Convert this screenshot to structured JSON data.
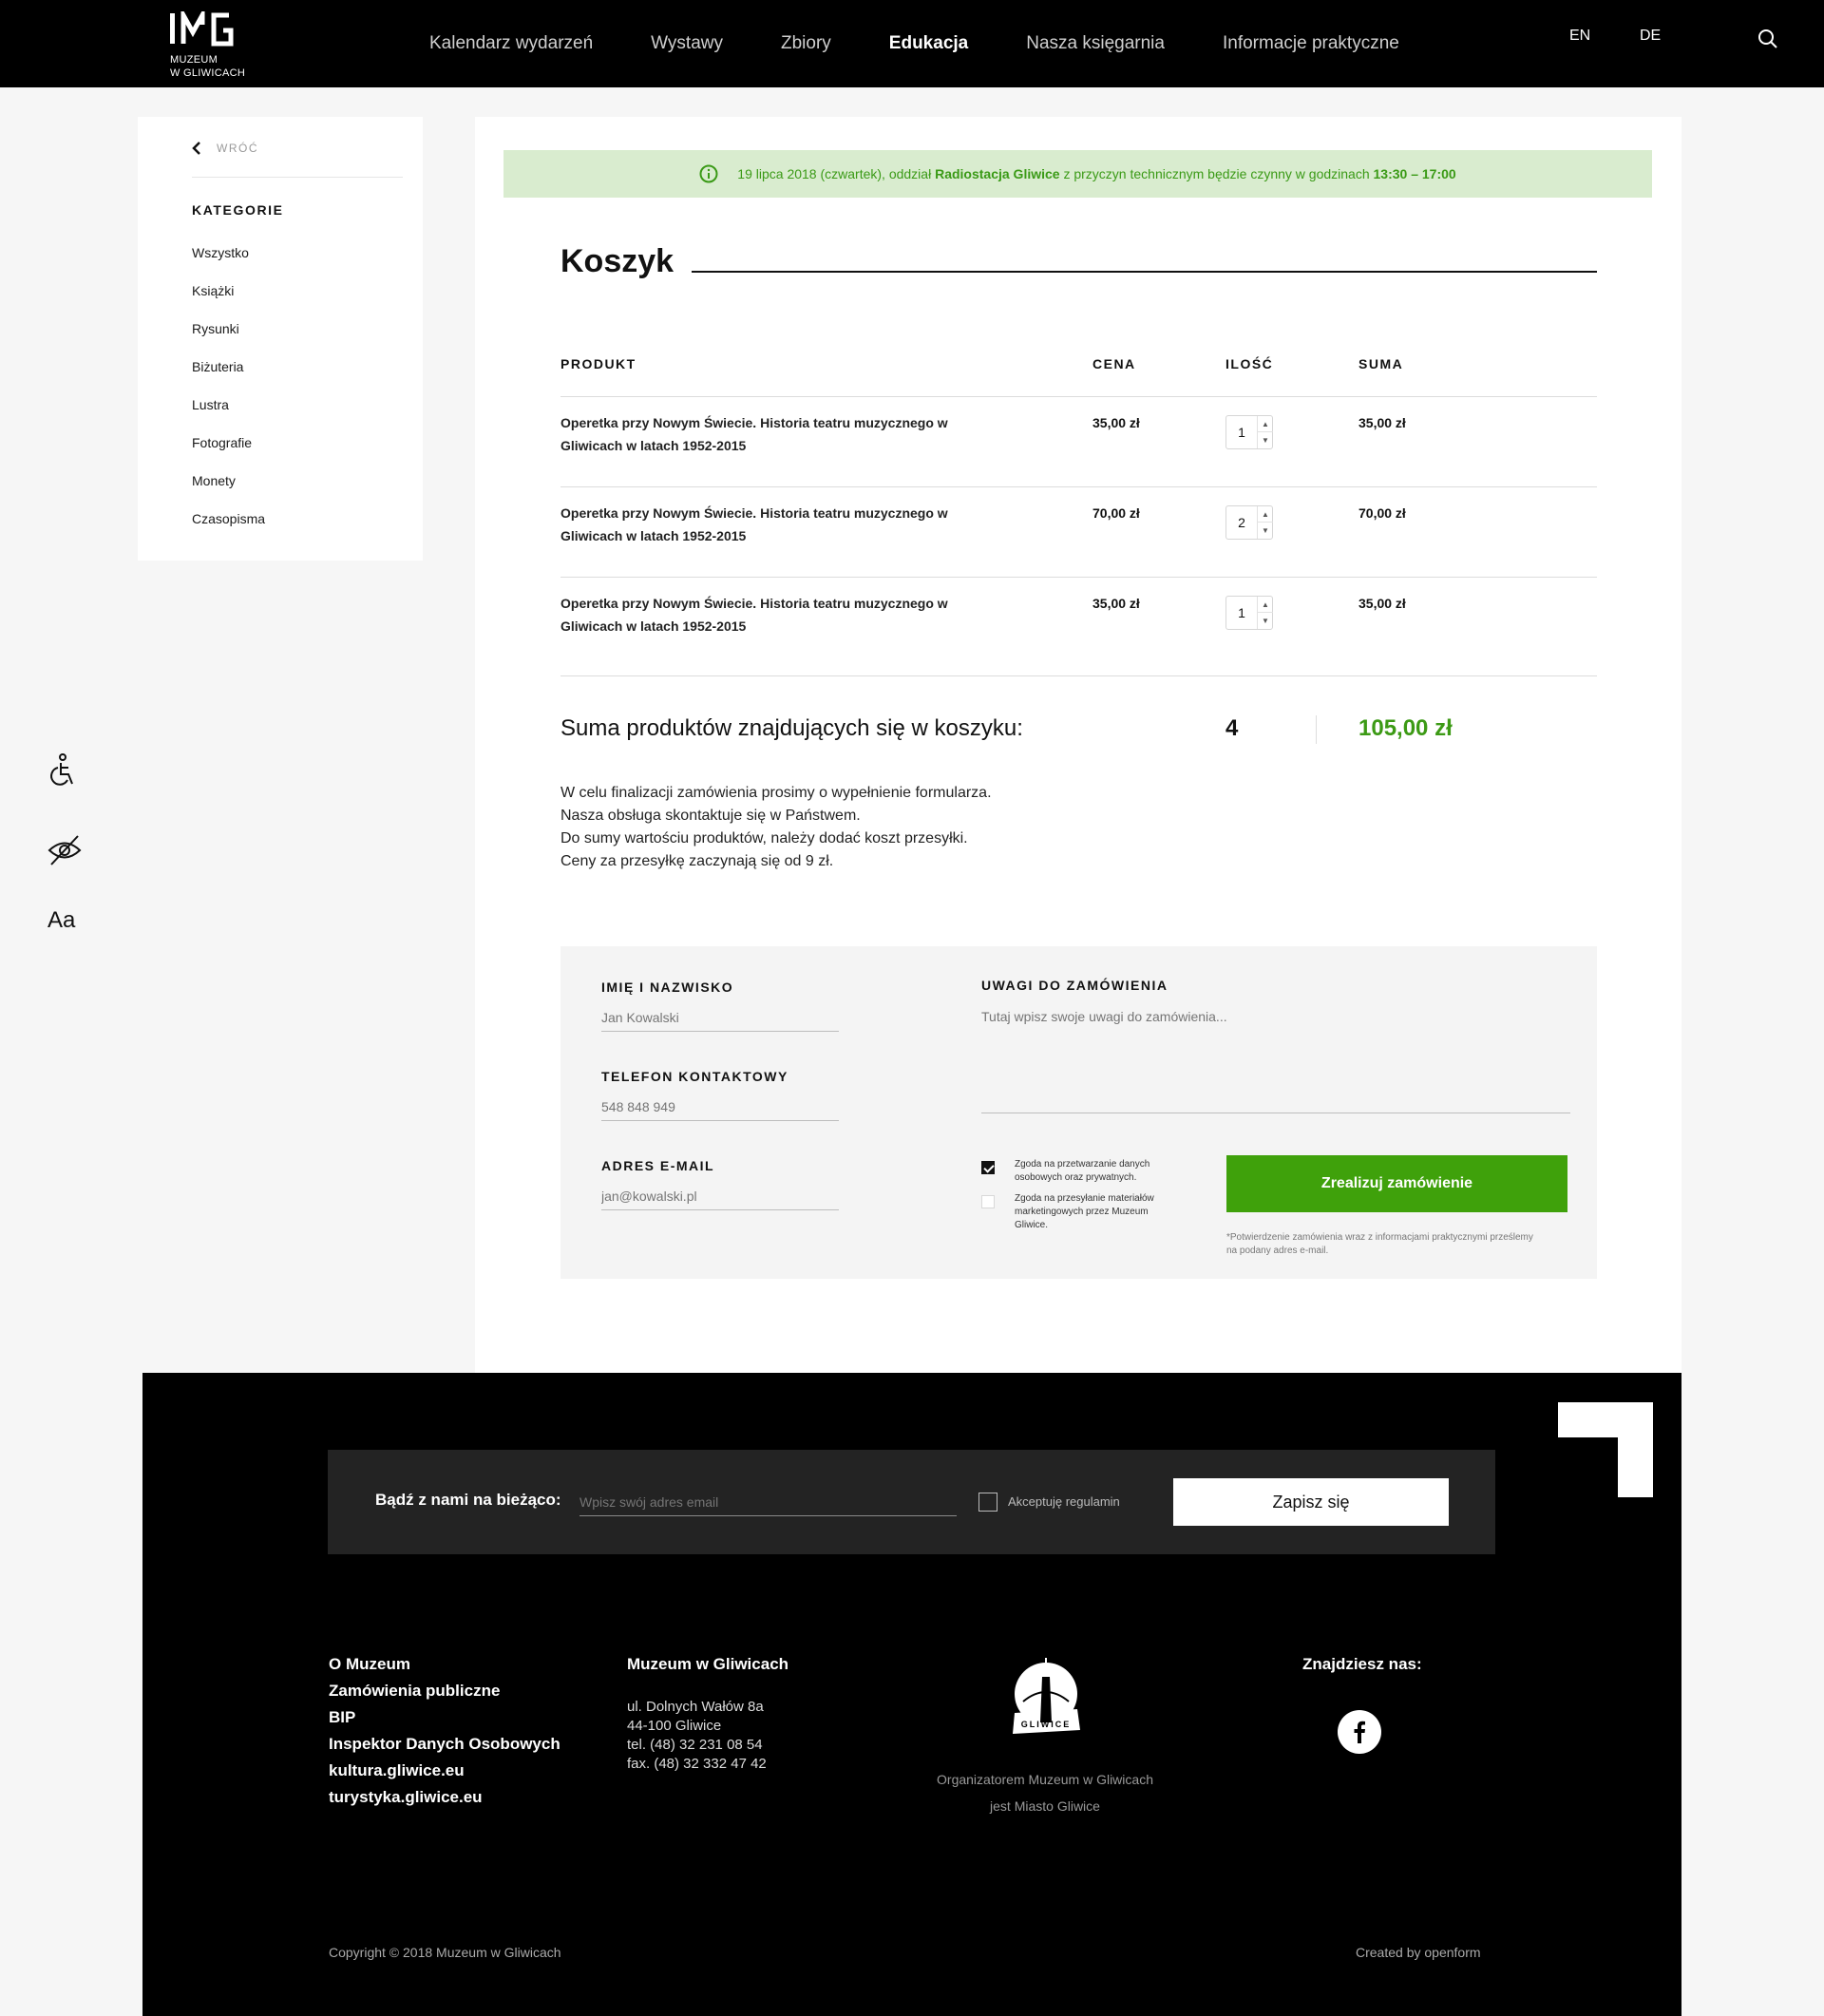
{
  "header": {
    "logo_line1": "MUZEUM",
    "logo_line2": "W GLIWICACH",
    "nav": [
      {
        "label": "Kalendarz wydarzeń"
      },
      {
        "label": "Wystawy"
      },
      {
        "label": "Zbiory"
      },
      {
        "label": "Edukacja",
        "active": true
      },
      {
        "label": "Nasza księgarnia"
      },
      {
        "label": "Informacje praktyczne"
      }
    ],
    "lang_en": "EN",
    "lang_de": "DE"
  },
  "sidebar": {
    "back_label": "WRÓĆ",
    "categories_title": "KATEGORIE",
    "categories": [
      "Wszystko",
      "Książki",
      "Rysunki",
      "Biżuteria",
      "Lustra",
      "Fotografie",
      "Monety",
      "Czasopisma"
    ]
  },
  "notice": {
    "part1": "19 lipca 2018 (czwartek), oddział ",
    "bold1": "Radiostacja Gliwice",
    "part2": " z przyczyn technicznym będzie czynny w godzinach ",
    "bold2": "13:30 – 17:00"
  },
  "cart": {
    "title": "Koszyk",
    "headers": {
      "product": "PRODUKT",
      "price": "CENA",
      "qty": "ILOŚĆ",
      "sum": "SUMA"
    },
    "rows": [
      {
        "name": "Operetka przy Nowym Świecie. Historia teatru muzycznego w Gliwicach w latach 1952-2015",
        "price": "35,00 zł",
        "qty": "1",
        "sum": "35,00 zł"
      },
      {
        "name": "Operetka przy Nowym Świecie. Historia teatru muzycznego w Gliwicach w latach 1952-2015",
        "price": "70,00 zł",
        "qty": "2",
        "sum": "70,00 zł"
      },
      {
        "name": "Operetka przy Nowym Świecie. Historia teatru muzycznego w Gliwicach w latach 1952-2015",
        "price": "35,00 zł",
        "qty": "1",
        "sum": "35,00 zł"
      }
    ],
    "total_label": "Suma produktów znajdujących się w koszyku:",
    "total_qty": "4",
    "total_sum": "105,00 zł",
    "info_lines": [
      "W celu finalizacji zamówienia prosimy o wypełnienie formularza.",
      "Nasza obsługa skontaktuje się w Państwem.",
      "Do sumy wartościu produktów, należy dodać koszt przesyłki.",
      "Ceny za przesyłkę zaczynają się od 9 zł."
    ]
  },
  "form": {
    "name_label": "IMIĘ I NAZWISKO",
    "name_placeholder": "Jan Kowalski",
    "phone_label": "TELEFON KONTAKTOWY",
    "phone_placeholder": "548 848 949",
    "email_label": "ADRES E-MAIL",
    "email_placeholder": "jan@kowalski.pl",
    "notes_label": "UWAGI DO ZAMÓWIENIA",
    "notes_placeholder": "Tutaj wpisz swoje uwagi do zamówienia...",
    "consent1": "Zgoda na przetwarzanie danych osobowych oraz prywatnych.",
    "consent2": "Zgoda na przesyłanie materiałów marketingowych przez Muzeum Gliwice.",
    "submit": "Zrealizuj zamówienie",
    "footnote": "*Potwierdzenie zamówienia wraz z informacjami praktycznymi prześlemy na podany adres e-mail."
  },
  "accessibility": {
    "font_label": "Aa"
  },
  "footer": {
    "newsletter_label": "Bądź z nami na bieżąco:",
    "newsletter_placeholder": "Wpisz swój adres email",
    "terms_label": "Akceptuję regulamin",
    "subscribe": "Zapisz się",
    "links": [
      "O Muzeum",
      "Zamówienia publiczne",
      "BIP",
      "Inspektor Danych Osobowych",
      "kultura.gliwice.eu",
      "turystyka.gliwice.eu"
    ],
    "address_title": "Muzeum w Gliwicach",
    "address_line1": "ul. Dolnych Wałów 8a",
    "address_line2": "44-100 Gliwice",
    "phone": "tel. (48) 32 231 08 54",
    "fax": "fax. (48) 32 332 47 42",
    "emblem_text": "GLIWICE",
    "org_line1": "Organizatorem Muzeum w Gliwicach",
    "org_line2": "jest Miasto Gliwice",
    "find_us": "Znajdziesz nas:",
    "copyright": "Copyright © 2018 Muzeum w Gliwicach",
    "created_by": "Created by openform"
  },
  "colors": {
    "accent_green": "#3fa10b",
    "notice_bg": "#d9eccf",
    "header_bg": "#000000"
  }
}
